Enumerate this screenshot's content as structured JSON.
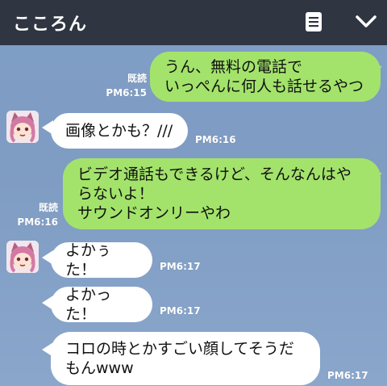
{
  "header": {
    "title": "こころん",
    "icons": [
      "notes-icon",
      "chevron-down-icon"
    ]
  },
  "messages": [
    {
      "side": "out",
      "text": "うん、無料の電話で\nいっぺんに何人も話せるやつ",
      "read": "既読",
      "time": "PM6:15"
    },
    {
      "side": "in",
      "text": "画像とかも？///",
      "time": "PM6:16"
    },
    {
      "side": "out",
      "text": "ビデオ通話もできるけど、そんなんはや\nらないよ！\nサウンドオンリーやわ",
      "read": "既読",
      "time": "PM6:16"
    },
    {
      "side": "in",
      "text": "よかぅた！",
      "time": "PM6:17"
    },
    {
      "side": "in",
      "text": "よかった！",
      "time": "PM6:17"
    },
    {
      "side": "in",
      "text": "コロの時とかすごい顔してそうだ\nもんwww",
      "time": "PM6:17"
    }
  ],
  "colors": {
    "header_bg": "#2f3541",
    "chat_bg": "#7f9ec6",
    "bubble_out": "#a3e36b",
    "bubble_in": "#ffffff"
  }
}
